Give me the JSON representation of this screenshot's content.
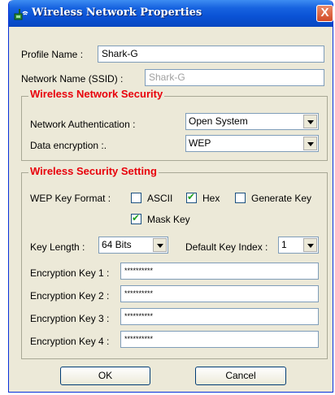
{
  "window": {
    "title": "Wireless Network Properties",
    "close_glyph": "X"
  },
  "profile": {
    "profile_name_label": "Profile Name :",
    "profile_name_value": "Shark-G",
    "ssid_label": "Network Name (SSID) :",
    "ssid_value": "Shark-G"
  },
  "security": {
    "group_title": "Wireless Network Security",
    "auth_label": "Network Authentication :",
    "auth_value": "Open System",
    "encryption_label": "Data encryption :.",
    "encryption_value": "WEP"
  },
  "wep": {
    "group_title": "Wireless Security Setting",
    "key_format_label": "WEP Key Format :",
    "ascii_label": "ASCII",
    "ascii_checked": false,
    "hex_label": "Hex",
    "hex_checked": true,
    "generate_key_label": "Generate Key",
    "generate_key_checked": false,
    "mask_key_label": "Mask Key",
    "mask_key_checked": true,
    "key_length_label": "Key Length :",
    "key_length_value": "64 Bits",
    "default_key_index_label": "Default Key Index :",
    "default_key_index_value": "1",
    "keys": [
      {
        "label": "Encryption Key 1 :",
        "value": "**********"
      },
      {
        "label": "Encryption Key 2 :",
        "value": "**********"
      },
      {
        "label": "Encryption Key 3 :",
        "value": "**********"
      },
      {
        "label": "Encryption Key 4 :",
        "value": "**********"
      }
    ]
  },
  "buttons": {
    "ok_label": "OK",
    "cancel_label": "Cancel"
  },
  "colors": {
    "titlebar": "#0a53d6",
    "group_title": "#e8000b",
    "dialog_bg": "#ece9d8"
  }
}
